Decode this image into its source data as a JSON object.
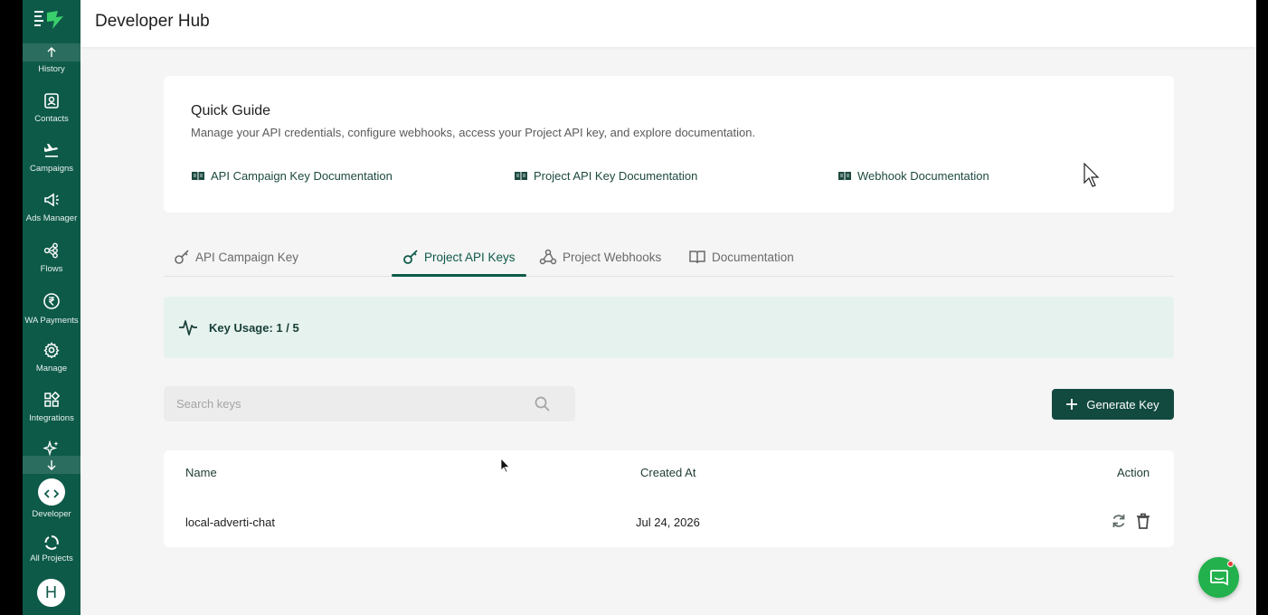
{
  "header": {
    "title": "Developer Hub"
  },
  "sidebar": {
    "items": [
      {
        "label": "History",
        "icon": "arrow-up-icon"
      },
      {
        "label": "Contacts",
        "icon": "contacts-icon"
      },
      {
        "label": "Campaigns",
        "icon": "plane-icon"
      },
      {
        "label": "Ads Manager",
        "icon": "megaphone-icon"
      },
      {
        "label": "Flows",
        "icon": "flows-icon"
      },
      {
        "label": "WA Payments",
        "icon": "rupee-icon"
      },
      {
        "label": "Manage",
        "icon": "gear-icon"
      },
      {
        "label": "Integrations",
        "icon": "grid-icon"
      },
      {
        "label": "Developer",
        "icon": "code-icon"
      },
      {
        "label": "All Projects",
        "icon": "projects-icon"
      }
    ],
    "avatar_initial": "H"
  },
  "quick_guide": {
    "title": "Quick Guide",
    "description": "Manage your API credentials, configure webhooks, access your Project API key, and explore documentation.",
    "links": [
      "API Campaign Key Documentation",
      "Project API Key Documentation",
      "Webhook Documentation"
    ]
  },
  "tabs": [
    {
      "label": "API Campaign Key",
      "active": false
    },
    {
      "label": "Project API Keys",
      "active": true
    },
    {
      "label": "Project Webhooks",
      "active": false
    },
    {
      "label": "Documentation",
      "active": false
    }
  ],
  "usage": {
    "text": "Key Usage: 1 / 5"
  },
  "search": {
    "placeholder": "Search keys"
  },
  "generate_button": {
    "label": "Generate Key"
  },
  "table": {
    "columns": [
      "Name",
      "Created At",
      "Action"
    ],
    "rows": [
      {
        "name": "local-adverti-chat",
        "created_at": "Jul 24, 2026"
      }
    ]
  },
  "colors": {
    "brand": "#0e5a49",
    "button": "#124a3f",
    "usage_bg": "#e6f2ee",
    "chat": "#22b14c"
  }
}
